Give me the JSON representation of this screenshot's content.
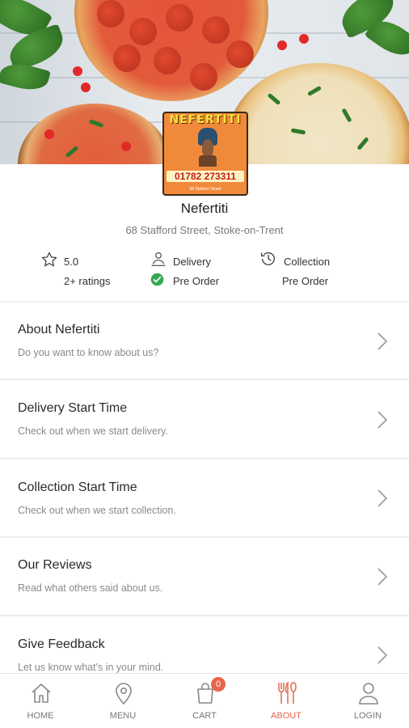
{
  "restaurant": {
    "logo_title": "NEFERTITI",
    "logo_phone": "01782 273311",
    "logo_subtext": "68 Stafford Street",
    "name": "Nefertiti",
    "address": "68 Stafford Street, Stoke-on-Trent"
  },
  "stats": {
    "rating_value": "5.0",
    "rating_count": "2+ ratings",
    "delivery_label": "Delivery",
    "delivery_status": "Pre Order",
    "collection_label": "Collection",
    "collection_status": "Pre Order"
  },
  "menu_items": [
    {
      "title": "About Nefertiti",
      "subtitle": "Do you want to know about us?"
    },
    {
      "title": "Delivery Start Time",
      "subtitle": "Check out when we start delivery."
    },
    {
      "title": "Collection Start Time",
      "subtitle": "Check out when we start collection."
    },
    {
      "title": "Our Reviews",
      "subtitle": "Read what others said about us."
    },
    {
      "title": "Give Feedback",
      "subtitle": "Let us know what's in your mind."
    }
  ],
  "nav": {
    "home": "HOME",
    "menu": "MENU",
    "cart": "CART",
    "cart_count": "0",
    "about": "ABOUT",
    "login": "LOGIN",
    "active": "about"
  },
  "colors": {
    "accent": "#e8664a",
    "success": "#34a853",
    "logo_bg": "#f08a3a"
  },
  "icons": {
    "rating": "star-icon",
    "delivery": "delivery-icon",
    "delivery_status": "check-circle-icon",
    "collection": "clock-history-icon",
    "chevron": "chevron-right-icon",
    "home": "home-icon",
    "menu": "map-pin-icon",
    "cart": "shopping-bag-icon",
    "about": "cutlery-icon",
    "login": "user-icon"
  }
}
